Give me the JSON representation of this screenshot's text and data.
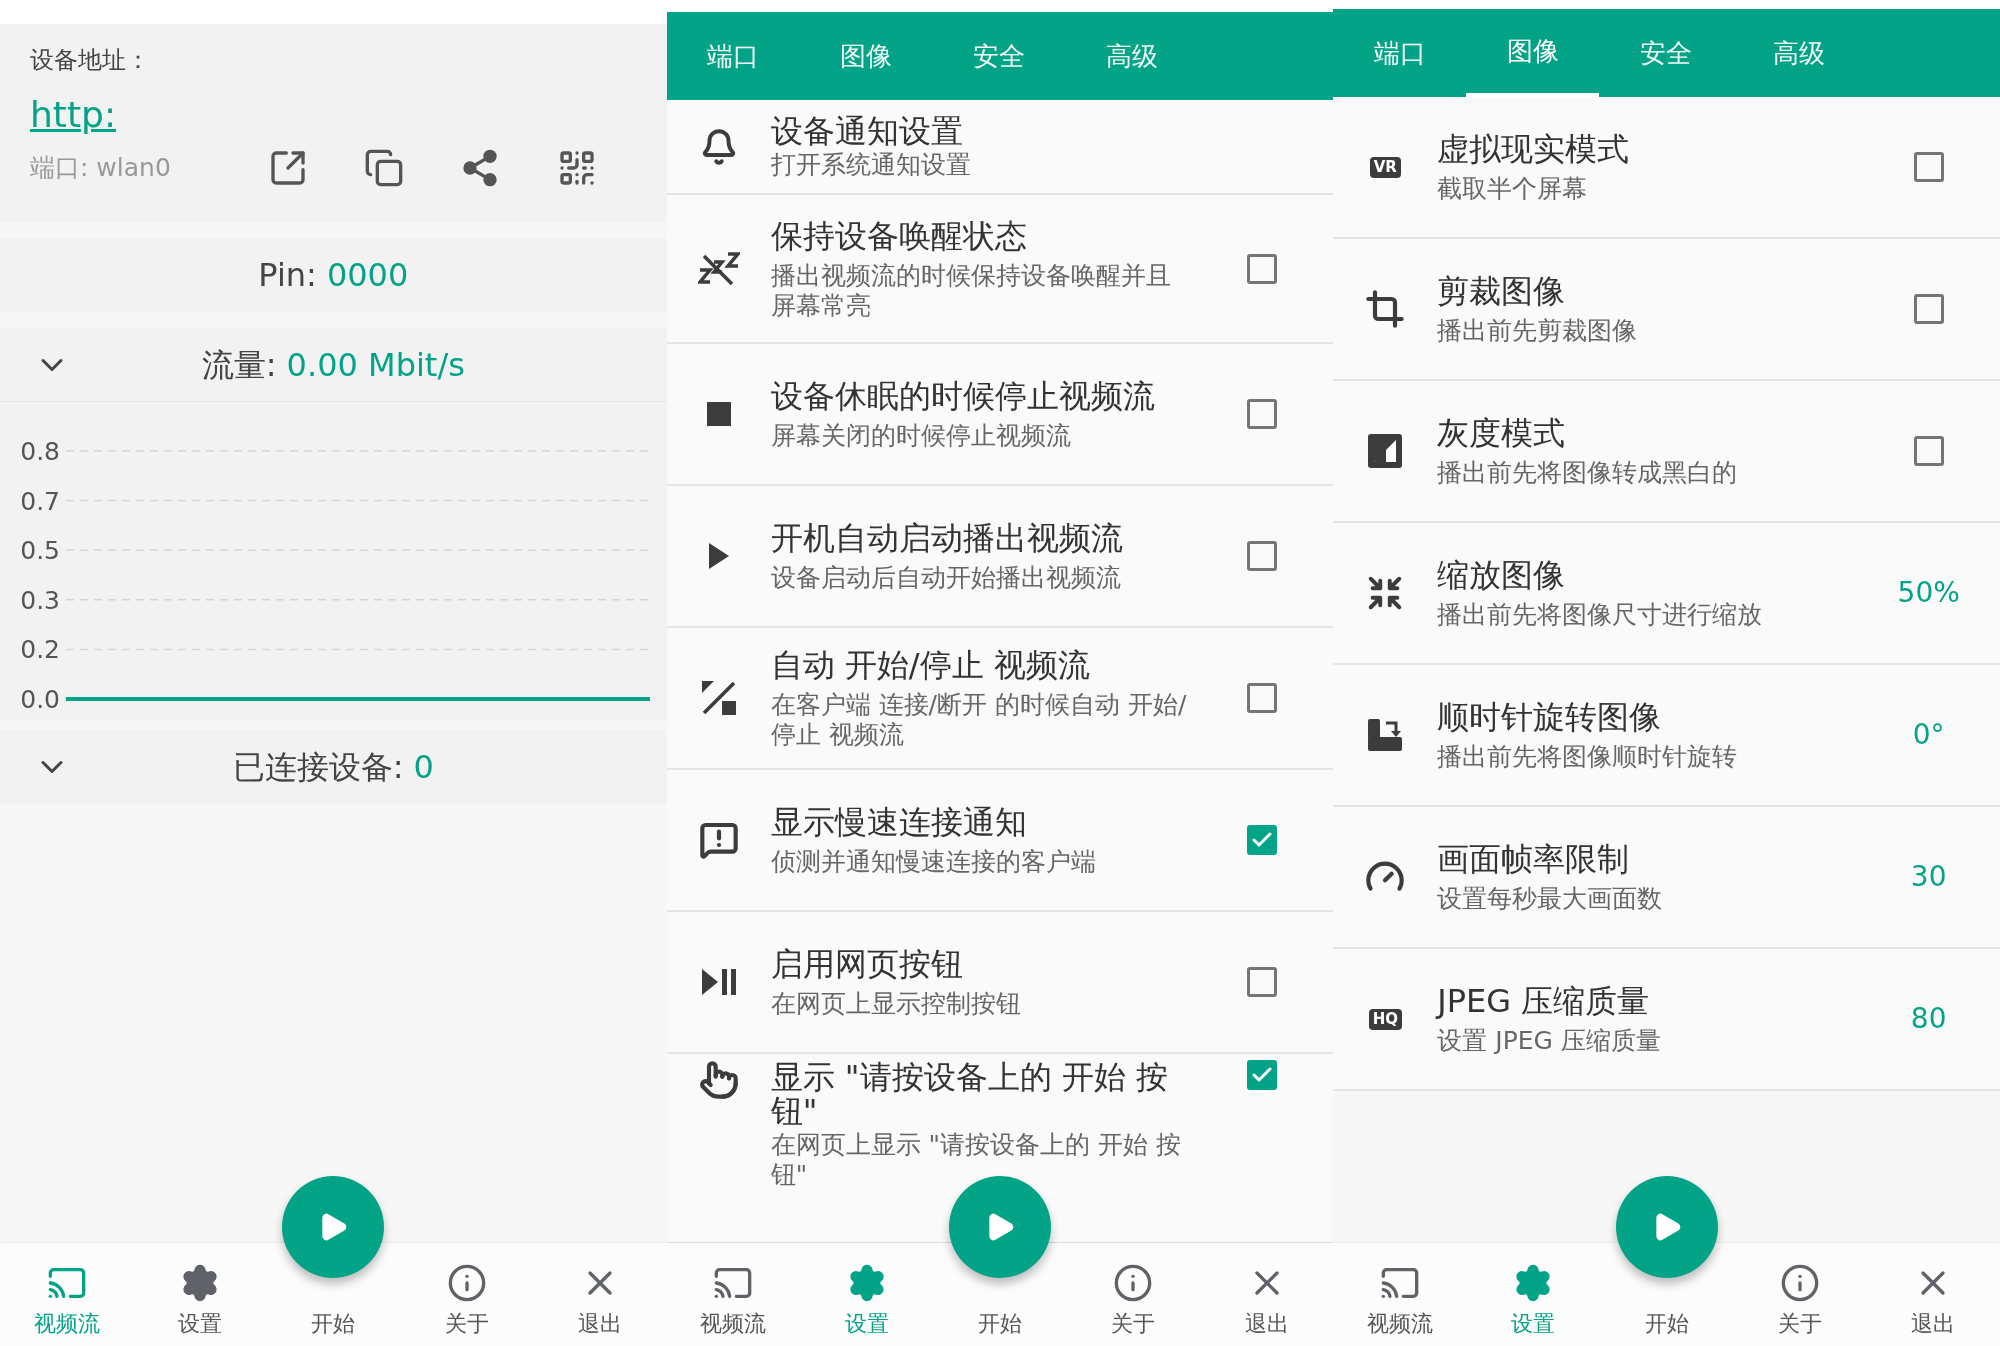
{
  "panels": [
    {
      "kind": "status",
      "address_label": "设备地址：",
      "address_link": "http:",
      "port": "端口: wlan0",
      "pin_label": "Pin:",
      "pin": "0000",
      "traffic_label": "流量:",
      "traffic": "0.00 Mbit/s",
      "chart_data": {
        "type": "line",
        "grid": true,
        "ylim": [
          0,
          0.8333
        ],
        "yticks": [
          {
            "value": 0.8333,
            "label": "0.8"
          },
          {
            "value": 0.6667,
            "label": "0.7"
          },
          {
            "value": 0.5,
            "label": "0.5"
          },
          {
            "value": 0.3333,
            "label": "0.3"
          },
          {
            "value": 0.1667,
            "label": "0.2"
          },
          {
            "value": 0,
            "label": "0.0"
          }
        ],
        "values": [
          0,
          0,
          0,
          0,
          0,
          0,
          0,
          0,
          0,
          0
        ]
      },
      "clients_label": "已连接设备:",
      "clients": "0",
      "nav": [
        {
          "label": "视频流",
          "selected": true
        },
        {
          "label": "设置",
          "selected": false
        },
        {
          "label": "开始",
          "selected": false
        },
        {
          "label": "关于",
          "selected": false
        },
        {
          "label": "退出",
          "selected": false
        }
      ]
    },
    {
      "kind": "settings",
      "tabs": [
        {
          "label": "端口",
          "selected": false
        },
        {
          "label": "图像",
          "selected": false
        },
        {
          "label": "安全",
          "selected": false
        },
        {
          "label": "高级",
          "selected": false
        }
      ],
      "items": [
        {
          "kind": "link",
          "title": "设备通知设置",
          "subtitle": "打开系统通知设置"
        },
        {
          "kind": "checkbox",
          "title": "保持设备唤醒状态",
          "subtitle": "播出视频流的时候保持设备唤醒并且屏幕常亮",
          "checked": false
        },
        {
          "kind": "checkbox",
          "title": "设备休眠的时候停止视频流",
          "subtitle": "屏幕关闭的时候停止视频流",
          "checked": false
        },
        {
          "kind": "checkbox",
          "title": "开机自动启动播出视频流",
          "subtitle": "设备启动后自动开始播出视频流",
          "checked": false
        },
        {
          "kind": "checkbox",
          "title": "自动 开始/停止 视频流",
          "subtitle": "在客户端 连接/断开 的时候自动 开始/停止 视频流",
          "checked": false
        },
        {
          "kind": "checkbox",
          "title": "显示慢速连接通知",
          "subtitle": "侦测并通知慢速连接的客户端",
          "checked": true
        },
        {
          "kind": "checkbox",
          "title": "启用网页按钮",
          "subtitle": "在网页上显示控制按钮",
          "checked": false
        },
        {
          "kind": "checkbox",
          "title": "显示 \"请按设备上的 开始 按钮\"",
          "subtitle": "在网页上显示 \"请按设备上的 开始 按钮\"",
          "checked": true
        }
      ],
      "nav": [
        {
          "label": "视频流",
          "selected": false
        },
        {
          "label": "设置",
          "selected": true
        },
        {
          "label": "开始",
          "selected": false
        },
        {
          "label": "关于",
          "selected": false
        },
        {
          "label": "退出",
          "selected": false
        }
      ]
    },
    {
      "kind": "settings",
      "tabs": [
        {
          "label": "端口",
          "selected": false
        },
        {
          "label": "图像",
          "selected": true
        },
        {
          "label": "安全",
          "selected": false
        },
        {
          "label": "高级",
          "selected": false
        }
      ],
      "items": [
        {
          "kind": "checkbox",
          "badge": "VR",
          "title": "虚拟现实模式",
          "subtitle": "截取半个屏幕",
          "checked": false
        },
        {
          "kind": "checkbox",
          "title": "剪裁图像",
          "subtitle": "播出前先剪裁图像",
          "checked": false
        },
        {
          "kind": "checkbox",
          "title": "灰度模式",
          "subtitle": "播出前先将图像转成黑白的",
          "checked": false
        },
        {
          "kind": "value",
          "title": "缩放图像",
          "subtitle": "播出前先将图像尺寸进行缩放",
          "value": "50%"
        },
        {
          "kind": "value",
          "title": "顺时针旋转图像",
          "subtitle": "播出前先将图像顺时针旋转",
          "value": "0°"
        },
        {
          "kind": "value",
          "title": "画面帧率限制",
          "subtitle": "设置每秒最大画面数",
          "value": "30"
        },
        {
          "kind": "value",
          "badge": "HQ",
          "title": "JPEG 压缩质量",
          "subtitle": "设置 JPEG 压缩质量",
          "value": "80"
        }
      ],
      "nav": [
        {
          "label": "视频流",
          "selected": false
        },
        {
          "label": "设置",
          "selected": true
        },
        {
          "label": "开始",
          "selected": false
        },
        {
          "label": "关于",
          "selected": false
        },
        {
          "label": "退出",
          "selected": false
        }
      ]
    }
  ]
}
